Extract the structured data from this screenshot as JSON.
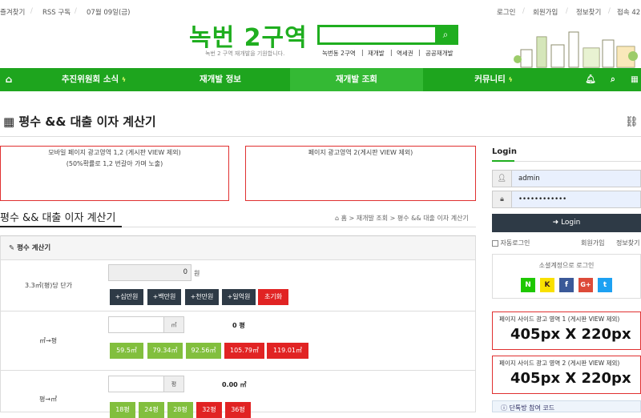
{
  "topbar": {
    "bookmark": "즐겨찾기",
    "rss": "RSS 구독",
    "date": "07월 09일(금)",
    "login": "로그인",
    "join": "회원가입",
    "find": "정보찾기",
    "visits": "접속 42"
  },
  "logo": {
    "title": "녹번 2구역",
    "tagline": "녹번 2 구역 재개발을 기원합니다."
  },
  "quicklinks": [
    "녹번동 2구역",
    "재개발",
    "역세권",
    "공공재개발"
  ],
  "nav": {
    "items": [
      "추진위원회 소식",
      "재개발 정보",
      "재개발 조회",
      "커뮤니티"
    ]
  },
  "page": {
    "title": "평수 && 대출 이자 계산기"
  },
  "ads": {
    "ad1_line1": "모바일 페이지 광고영역 1,2 (게시판 VIEW 제외)",
    "ad1_line2": "(50%확률로 1,2 번갈아 가며 노출)",
    "ad2": "페이지 광고영역 2(게시판 VIEW 제외)"
  },
  "section": {
    "title": "평수 && 대출 이자 계산기",
    "breadcrumb": "홈 > 재개발 조회 > 평수 && 대출 이자 계산기"
  },
  "calc": {
    "header": "평수 계산기",
    "row1": {
      "label": "3.3㎡(평)당 단가",
      "value": "0",
      "unit": "원",
      "buttons": [
        "+십만원",
        "+백만원",
        "+천만원",
        "+일억원",
        "초기화"
      ]
    },
    "row2": {
      "label": "㎡→평",
      "unit": "㎡",
      "result": "0 평",
      "buttons": [
        "59.5㎡",
        "79.34㎡",
        "92.56㎡",
        "105.79㎡",
        "119.01㎡"
      ]
    },
    "row3": {
      "label": "평→㎡",
      "unit": "평",
      "result": "0.00 ㎡",
      "buttons": [
        "18평",
        "24평",
        "28평",
        "32평",
        "36평"
      ]
    }
  },
  "login": {
    "tab": "Login",
    "user": "admin",
    "password": "••••••••••••",
    "button": "Login",
    "auto": "자동로그인",
    "join": "회원가입",
    "find": "정보찾기",
    "social_title": "소셜계정으로 로그인"
  },
  "social": [
    "N",
    "K",
    "f",
    "G+",
    "t"
  ],
  "side_ads": [
    {
      "title": "페이지 사이드 광고 영역 1 (게시판 VIEW 제외)",
      "size": "405px X 220px"
    },
    {
      "title": "페이지 사이드 광고 영역 2 (게시판 VIEW 제외)",
      "size": "405px X 220px"
    }
  ],
  "bottom_box": "단톡방 참여 코드"
}
